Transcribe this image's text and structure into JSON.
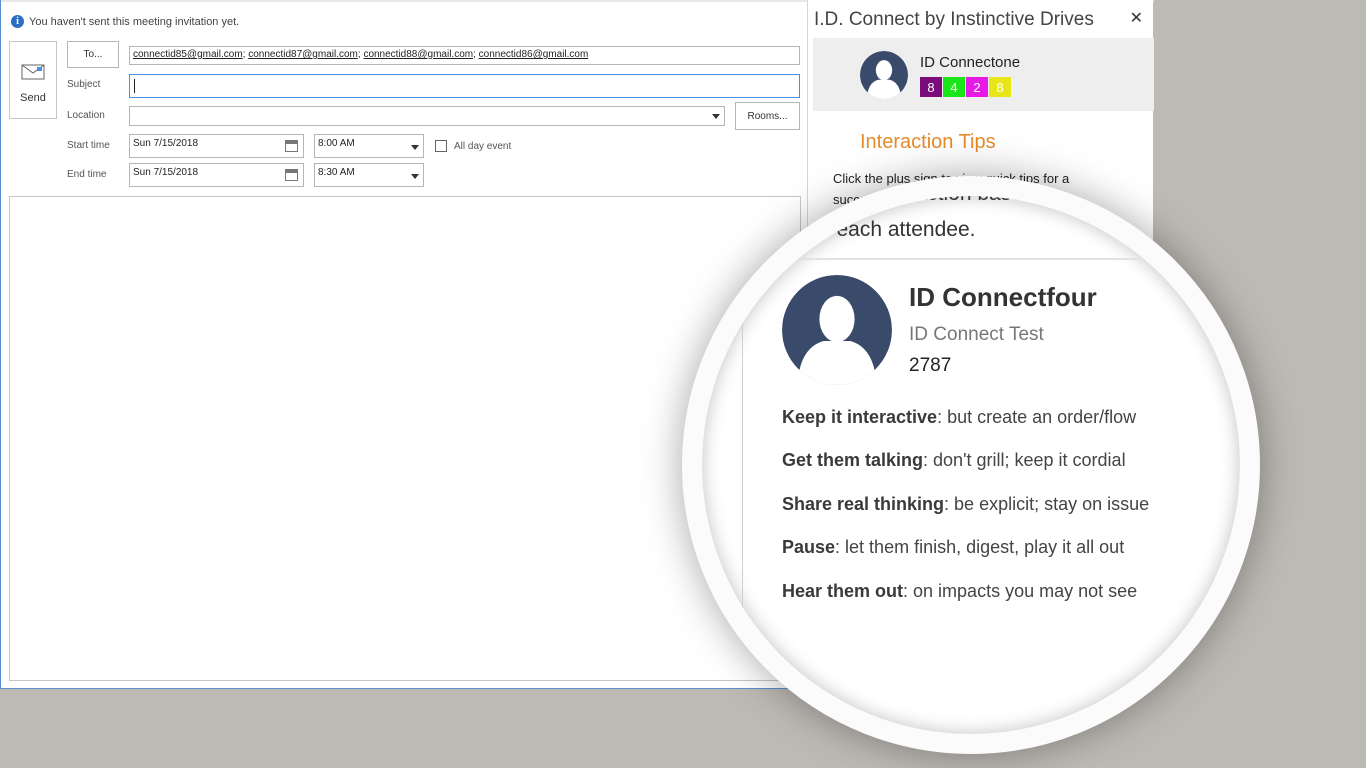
{
  "info_bar": {
    "text": "You haven't sent this meeting invitation yet."
  },
  "send": {
    "label": "Send"
  },
  "to": {
    "button_label": "To...",
    "recipients": [
      "connectid85@gmail.com",
      "connectid87@gmail.com",
      "connectid88@gmail.com",
      "connectid86@gmail.com"
    ]
  },
  "subject": {
    "label": "Subject",
    "value": ""
  },
  "location": {
    "label": "Location",
    "value": "",
    "rooms_button": "Rooms..."
  },
  "start": {
    "label": "Start time",
    "date": "Sun 7/15/2018",
    "time": "8:00 AM"
  },
  "end": {
    "label": "End time",
    "date": "Sun 7/15/2018",
    "time": "8:30 AM"
  },
  "all_day": {
    "label": "All day event",
    "checked": false
  },
  "pane": {
    "title": "I.D. Connect by Instinctive Drives",
    "close_glyph": "✕",
    "contact": {
      "name": "ID Connectone",
      "scores": [
        {
          "value": "8",
          "color": "#7b0b7b"
        },
        {
          "value": "4",
          "color": "#19e619"
        },
        {
          "value": "2",
          "color": "#e619e6"
        },
        {
          "value": "8",
          "color": "#e6e619"
        }
      ]
    },
    "tips_title": "Interaction Tips",
    "tips_intro": "Click the plus sign to view quick tips for a successful interaction based around the"
  },
  "magnifier": {
    "fragment_line1": "teraction based",
    "fragment_line2": "or each attendee.",
    "contact": {
      "name": "ID Connectfour",
      "organization": "ID Connect Test",
      "number": "2787"
    },
    "tips": [
      {
        "bold": "Keep it interactive",
        "rest": ": but create an order/flow"
      },
      {
        "bold": "Get them talking",
        "rest": ": don't grill; keep it cordial"
      },
      {
        "bold": "Share real thinking",
        "rest": ": be explicit; stay on issue"
      },
      {
        "bold": "Pause",
        "rest": ": let them finish, digest, play it all out"
      },
      {
        "bold": "Hear them out",
        "rest": ": on impacts you may not see"
      }
    ]
  },
  "colors": {
    "accent_orange": "#e48b2a",
    "avatar_blue": "#3a4a6b",
    "window_border": "#5a8fd0"
  }
}
